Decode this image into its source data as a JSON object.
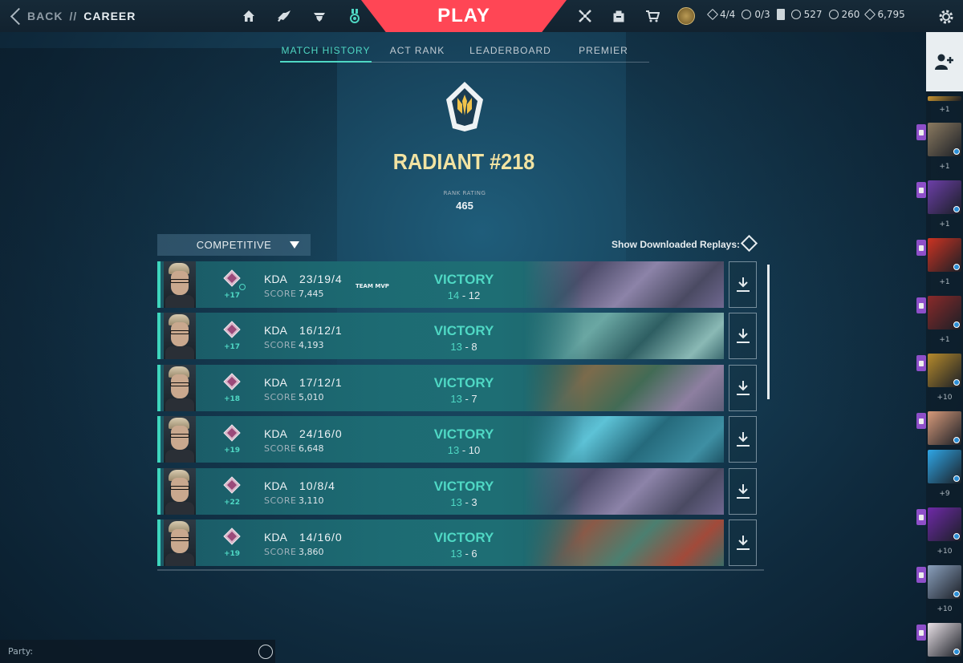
{
  "nav": {
    "back_label": "BACK",
    "separator": "//",
    "crumb": "CAREER",
    "play_label": "PLAY",
    "icons_left": [
      "home-icon",
      "collection-icon",
      "agents-icon",
      "career-icon"
    ],
    "icons_right": [
      "battlepass-icon",
      "store-backpack-icon",
      "store-cart-icon",
      "account-rank-icon"
    ]
  },
  "currencies": {
    "level_stars": "4/4",
    "dailies": "0/3",
    "radianite": "527",
    "kingdom": "260",
    "valorant_points": "6,795"
  },
  "tabs": [
    {
      "label": "MATCH HISTORY",
      "active": true
    },
    {
      "label": "ACT RANK",
      "active": false
    },
    {
      "label": "LEADERBOARD",
      "active": false
    },
    {
      "label": "PREMIER",
      "active": false
    }
  ],
  "rank": {
    "title": "RADIANT #218",
    "rr_label": "RANK RATING",
    "rr_value": "465"
  },
  "filters": {
    "queue": "COMPETITIVE",
    "replays_label": "Show Downloaded Replays:"
  },
  "matches": [
    {
      "rr": "+17",
      "kda_label": "KDA",
      "kda": "23/19/4",
      "score_label": "SCORE",
      "score": "7,445",
      "mvp": "TEAM MVP",
      "result": "VICTORY",
      "won": "14",
      "dash": "-",
      "lost": "12"
    },
    {
      "rr": "+17",
      "kda_label": "KDA",
      "kda": "16/12/1",
      "score_label": "SCORE",
      "score": "4,193",
      "mvp": "",
      "result": "VICTORY",
      "won": "13",
      "dash": "-",
      "lost": "8"
    },
    {
      "rr": "+18",
      "kda_label": "KDA",
      "kda": "17/12/1",
      "score_label": "SCORE",
      "score": "5,010",
      "mvp": "",
      "result": "VICTORY",
      "won": "13",
      "dash": "-",
      "lost": "7"
    },
    {
      "rr": "+19",
      "kda_label": "KDA",
      "kda": "24/16/0",
      "score_label": "SCORE",
      "score": "6,648",
      "mvp": "",
      "result": "VICTORY",
      "won": "13",
      "dash": "-",
      "lost": "10"
    },
    {
      "rr": "+22",
      "kda_label": "KDA",
      "kda": "10/8/4",
      "score_label": "SCORE",
      "score": "3,110",
      "mvp": "",
      "result": "VICTORY",
      "won": "13",
      "dash": "-",
      "lost": "3"
    },
    {
      "rr": "+19",
      "kda_label": "KDA",
      "kda": "14/16/0",
      "score_label": "SCORE",
      "score": "3,860",
      "mvp": "",
      "result": "VICTORY",
      "won": "13",
      "dash": "-",
      "lost": "6"
    }
  ],
  "social": {
    "friends": [
      {
        "badge": "+1",
        "color": "#c7932e"
      },
      {
        "badge": "+1",
        "color": "#8b7a60"
      },
      {
        "badge": "+1",
        "color": "#6c3fa8"
      },
      {
        "badge": "+1",
        "color": "#cc3322"
      },
      {
        "badge": "+1",
        "color": "#8a2a2a"
      },
      {
        "badge": "+10",
        "color": "#b58a2c"
      },
      {
        "badge": "",
        "color": "#d79a7a"
      },
      {
        "badge": "+9",
        "color": "#2fa6e6"
      },
      {
        "badge": "+10",
        "color": "#6f2aa8"
      },
      {
        "badge": "+10",
        "color": "#8aa0bd"
      },
      {
        "badge": "",
        "color": "#e8e0e6"
      }
    ]
  },
  "party": {
    "label": "Party:"
  },
  "colors": {
    "accent": "#4fd8c4",
    "play": "#ff4655",
    "rank_gold": "#f2e3a2"
  }
}
